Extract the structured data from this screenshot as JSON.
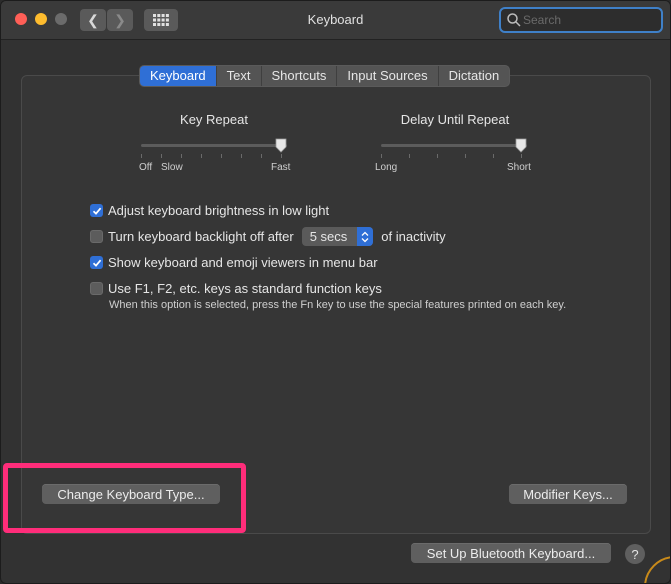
{
  "window": {
    "title": "Keyboard"
  },
  "search": {
    "placeholder": "Search",
    "value": ""
  },
  "tabs": [
    {
      "label": "Keyboard",
      "active": true
    },
    {
      "label": "Text",
      "active": false
    },
    {
      "label": "Shortcuts",
      "active": false
    },
    {
      "label": "Input Sources",
      "active": false
    },
    {
      "label": "Dictation",
      "active": false
    }
  ],
  "key_repeat": {
    "label": "Key Repeat",
    "min_label_1": "Off",
    "min_label_2": "Slow",
    "max_label": "Fast",
    "level": 1.0
  },
  "delay_until_repeat": {
    "label": "Delay Until Repeat",
    "min_label": "Long",
    "max_label": "Short",
    "level": 1.0
  },
  "options": [
    {
      "label": "Adjust keyboard brightness in low light",
      "checked": true
    },
    {
      "label": "Turn keyboard backlight off after",
      "checked": false,
      "popup_value": "5 secs",
      "suffix": "of inactivity"
    },
    {
      "label": "Show keyboard and emoji viewers in menu bar",
      "checked": true
    },
    {
      "label": "Use F1, F2, etc. keys as standard function keys",
      "checked": false
    }
  ],
  "fn_note": "When this option is selected, press the Fn key to use the special features printed on each key.",
  "buttons": {
    "change_keyboard_type": "Change Keyboard Type...",
    "modifier_keys": "Modifier Keys...",
    "setup_bluetooth": "Set Up Bluetooth Keyboard...",
    "help": "?"
  },
  "colors": {
    "accent": "#2f6fd6",
    "highlight": "#ff2d7a"
  }
}
